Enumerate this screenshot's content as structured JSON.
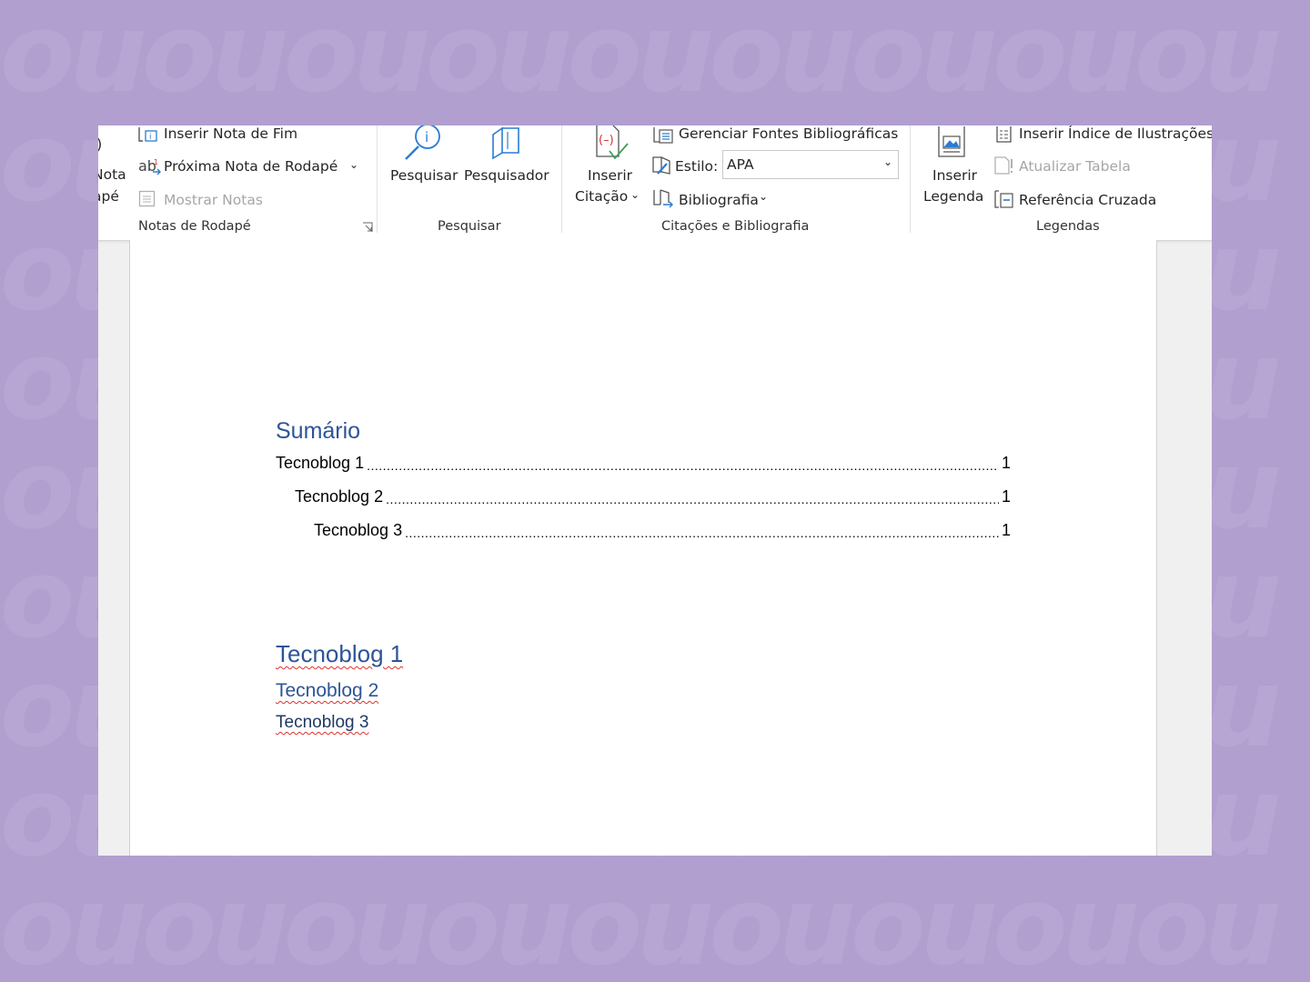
{
  "ribbon": {
    "footnotes": {
      "partial_button_line1": "Nota",
      "partial_button_line2": "apé",
      "insert_endnote": "Inserir Nota de Fim",
      "next_footnote": "Próxima Nota de Rodapé",
      "show_notes": "Mostrar Notas",
      "group_label": "Notas de Rodapé"
    },
    "research": {
      "search": "Pesquisar",
      "researcher": "Pesquisador",
      "group_label": "Pesquisar"
    },
    "citations": {
      "insert_citation_line1": "Inserir",
      "insert_citation_line2": "Citação",
      "manage_sources": "Gerenciar Fontes Bibliográficas",
      "style_label": "Estilo:",
      "style_value": "APA",
      "bibliography": "Bibliografia",
      "group_label": "Citações e Bibliografia"
    },
    "captions": {
      "insert_caption_line1": "Inserir",
      "insert_caption_line2": "Legenda",
      "insert_table_of_figures": "Inserir Índice de Ilustrações",
      "update_table": "Atualizar Tabela",
      "cross_reference": "Referência Cruzada",
      "group_label": "Legendas"
    }
  },
  "document": {
    "toc_title": "Sumário",
    "toc_entries": [
      {
        "text": "Tecnoblog 1",
        "page": "1"
      },
      {
        "text": "Tecnoblog 2",
        "page": "1"
      },
      {
        "text": "Tecnoblog 3",
        "page": "1"
      }
    ],
    "headings": [
      "Tecnoblog 1",
      "Tecnoblog 2",
      "Tecnoblog 3"
    ]
  },
  "colors": {
    "background": "#b19fcf",
    "heading_blue": "#2f5496",
    "icon_blue": "#2b7cd3",
    "spell_error": "#e0312d"
  }
}
